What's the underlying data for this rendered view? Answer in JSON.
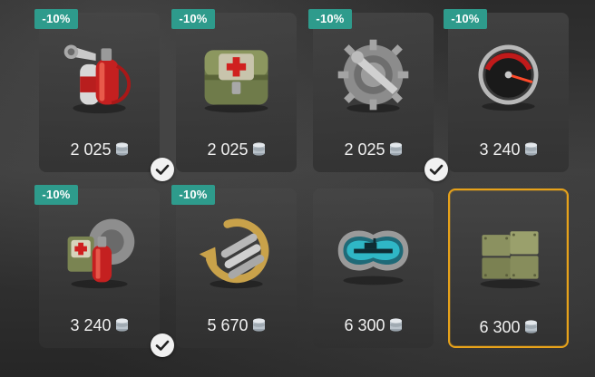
{
  "currency_icon": "silver-coin-stack-icon",
  "colors": {
    "discount_badge": "#2e9b8c",
    "selected_border": "#e7a21a",
    "price_text": "#f1f1f1"
  },
  "items": [
    {
      "discount": "-10%",
      "price": "2 025",
      "icon": "fire-extinguisher-icon",
      "owned": true,
      "selected": false
    },
    {
      "discount": "-10%",
      "price": "2 025",
      "icon": "medkit-icon",
      "owned": false,
      "selected": false
    },
    {
      "discount": "-10%",
      "price": "2 025",
      "icon": "repair-kit-gear-icon",
      "owned": true,
      "selected": false
    },
    {
      "discount": "-10%",
      "price": "3 240",
      "icon": "speedometer-icon",
      "owned": false,
      "selected": false
    },
    {
      "discount": "-10%",
      "price": "3 240",
      "icon": "combo-repair-kit-icon",
      "owned": true,
      "selected": false
    },
    {
      "discount": "-10%",
      "price": "5 670",
      "icon": "torpedo-reload-icon",
      "owned": false,
      "selected": false
    },
    {
      "discount": "",
      "price": "6 300",
      "icon": "sonar-periscope-icon",
      "owned": false,
      "selected": false
    },
    {
      "discount": "",
      "price": "6 300",
      "icon": "armor-plates-icon",
      "owned": false,
      "selected": true
    }
  ]
}
